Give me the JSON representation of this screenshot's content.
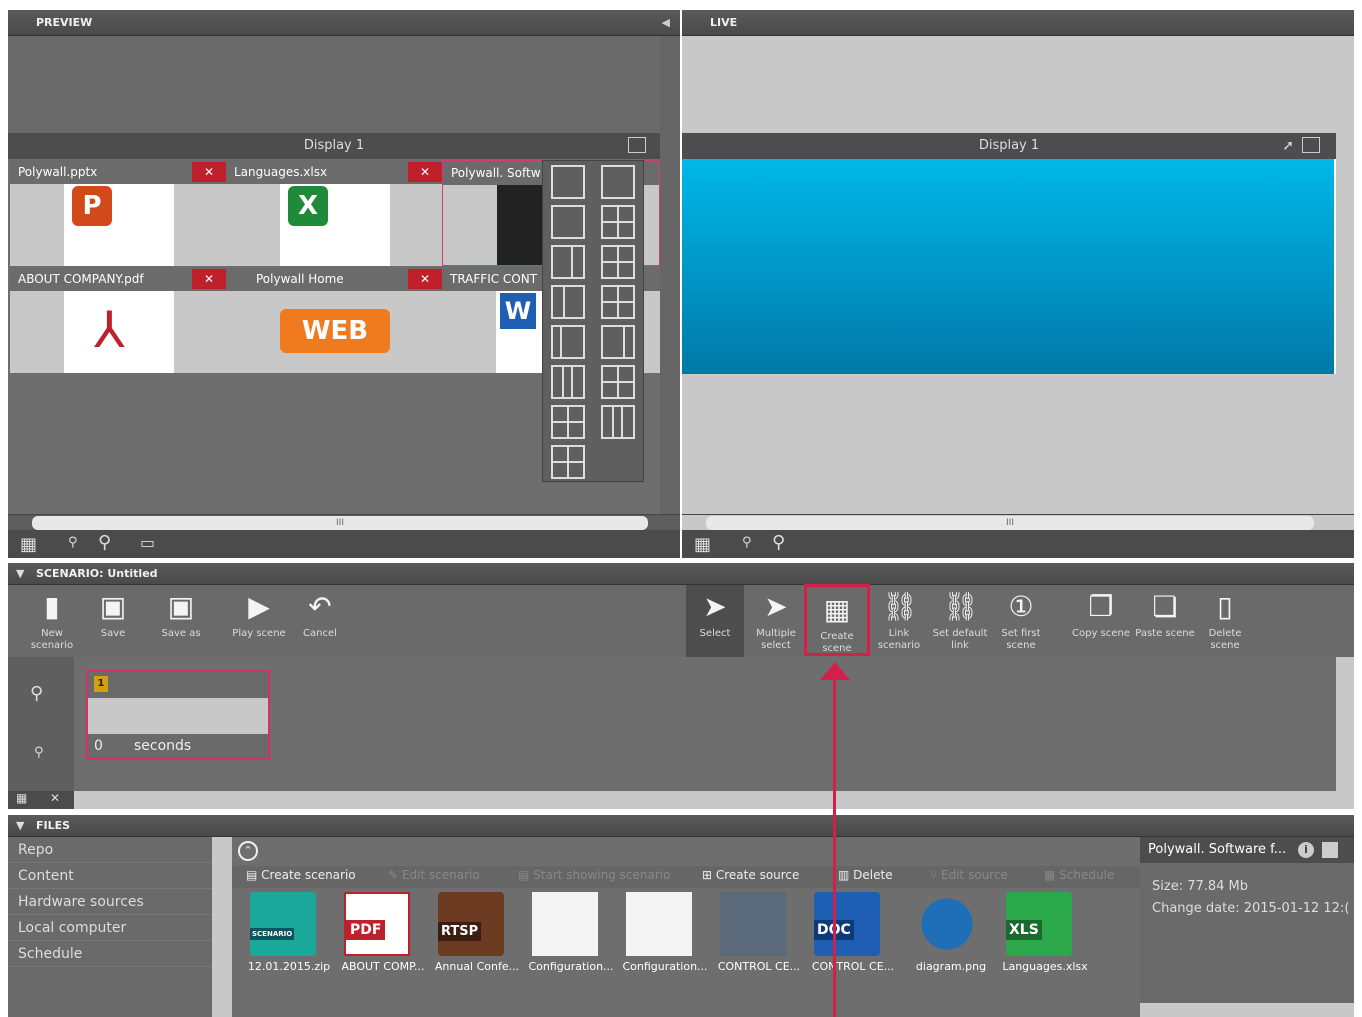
{
  "preview": {
    "title": "PREVIEW",
    "display": "Display 1",
    "tiles": [
      {
        "label": "Polywall.pptx"
      },
      {
        "label": "Languages.xlsx"
      },
      {
        "label": "Polywall. Softw"
      },
      {
        "label": "ABOUT COMPANY.pdf"
      },
      {
        "label": "Polywall Home"
      },
      {
        "label": "TRAFFIC CONT"
      }
    ]
  },
  "live": {
    "title": "LIVE",
    "display": "Display 1"
  },
  "scrollbar_grip": "III",
  "scenario": {
    "title": "SCENARIO: Untitled",
    "scene_number": "1",
    "scene_seconds_value": "0",
    "scene_seconds_label": "seconds",
    "toolbar": [
      {
        "label": "New scenario"
      },
      {
        "label": "Save"
      },
      {
        "label": "Save as"
      },
      {
        "label": "Play scene"
      },
      {
        "label": "Cancel"
      },
      {
        "label": "Select"
      },
      {
        "label": "Multiple select"
      },
      {
        "label": "Create scene"
      },
      {
        "label": "Link scenario"
      },
      {
        "label": "Set default link"
      },
      {
        "label": "Set first scene"
      },
      {
        "label": "Copy scene"
      },
      {
        "label": "Paste scene"
      },
      {
        "label": "Delete scene"
      }
    ]
  },
  "files": {
    "title": "FILES",
    "sidebar": [
      "Repo",
      "Content",
      "Hardware sources",
      "Local computer",
      "Schedule"
    ],
    "actions": [
      {
        "label": "Create scenario",
        "enabled": true
      },
      {
        "label": "Edit scenario",
        "enabled": false
      },
      {
        "label": "Start showing scenario",
        "enabled": false
      },
      {
        "label": "Create source",
        "enabled": true
      },
      {
        "label": "Delete",
        "enabled": true
      },
      {
        "label": "Edit source",
        "enabled": false
      },
      {
        "label": "Schedule",
        "enabled": false
      }
    ],
    "items": [
      {
        "name": "12.01.2015.zip",
        "badge": "SCENARIO"
      },
      {
        "name": "ABOUT COMP...",
        "badge": "PDF"
      },
      {
        "name": "Annual Confe...",
        "badge": "RTSP"
      },
      {
        "name": "Configuration...",
        "badge": ""
      },
      {
        "name": "Configuration...",
        "badge": ""
      },
      {
        "name": "CONTROL CE...",
        "badge": ""
      },
      {
        "name": "CONTROL CE...",
        "badge": "DOC"
      },
      {
        "name": "diagram.png",
        "badge": ""
      },
      {
        "name": "Languages.xlsx",
        "badge": "XLS"
      }
    ],
    "info": {
      "title": "Polywall. Software f...",
      "size": "Size: 77.84 Mb",
      "date": "Change date: 2015-01-12 12:("
    }
  }
}
